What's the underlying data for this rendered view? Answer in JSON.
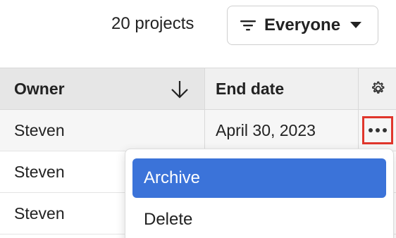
{
  "toolbar": {
    "project_count": "20 projects",
    "filter_label": "Everyone",
    "filter_icon": "filter-lines-icon",
    "caret_icon": "caret-down-icon"
  },
  "table": {
    "columns": [
      {
        "label": "Owner",
        "sort": "descending"
      },
      {
        "label": "End date"
      }
    ],
    "settings_icon": "gear-icon",
    "rows": [
      {
        "owner": "Steven",
        "end_date": "April 30, 2023",
        "selected": true
      },
      {
        "owner": "Steven",
        "end_date": ""
      },
      {
        "owner": "Steven",
        "end_date": ""
      }
    ],
    "row_action_icon": "more-horizontal-icon",
    "row_action_highlight": "#e0362c"
  },
  "row_menu": {
    "items": [
      {
        "label": "Archive",
        "active": true
      },
      {
        "label": "Delete",
        "active": false
      }
    ],
    "active_color": "#3b73d9"
  }
}
